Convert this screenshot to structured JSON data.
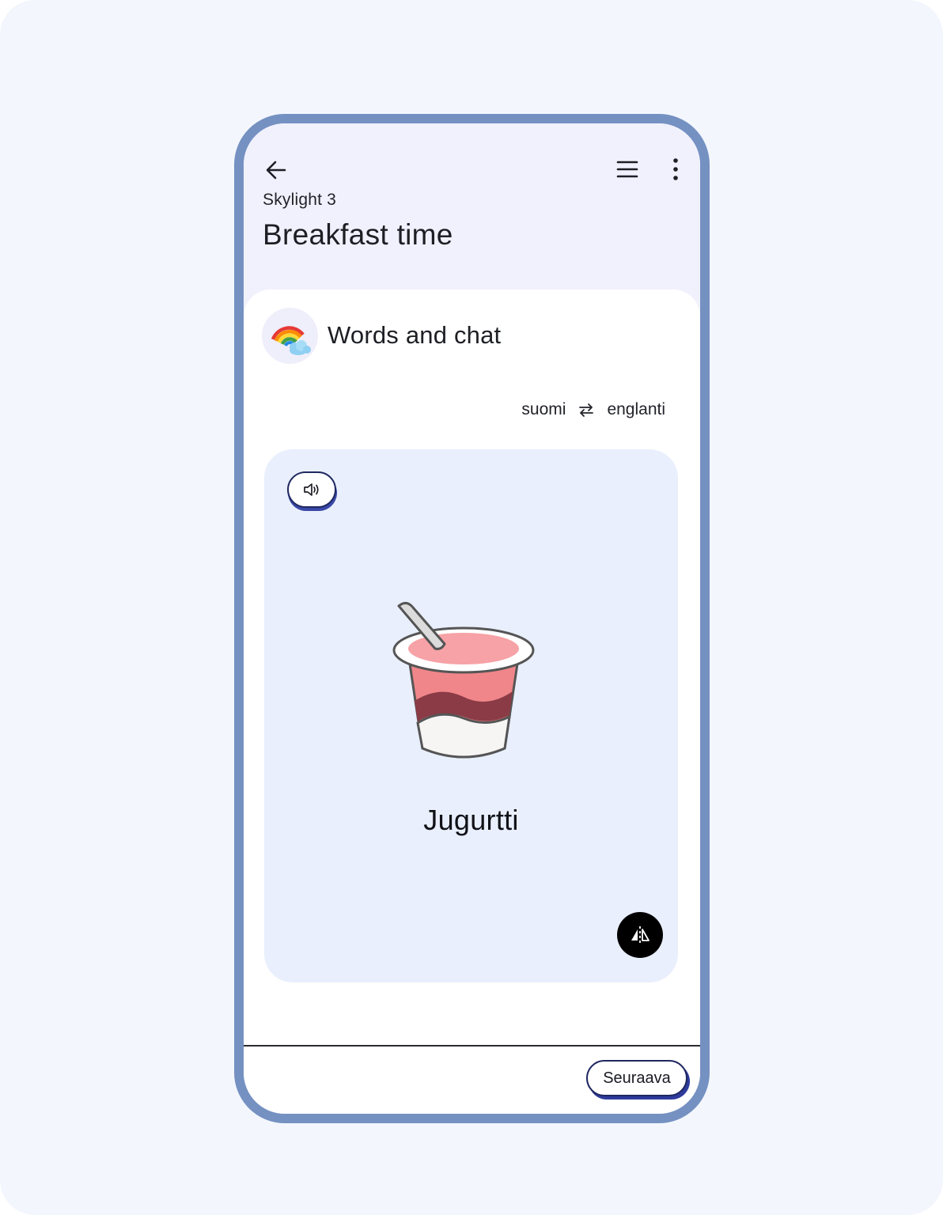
{
  "header": {
    "back_icon": "arrow-left-icon",
    "menu_icon": "hamburger-menu-icon",
    "more_icon": "more-vertical-icon",
    "course": "Skylight 3",
    "title": "Breakfast time"
  },
  "section": {
    "icon": "rainbow-icon",
    "title": "Words and chat"
  },
  "language": {
    "source": "suomi",
    "target": "englanti",
    "swap_icon": "swap-arrows-icon"
  },
  "card": {
    "audio_icon": "speaker-icon",
    "image": "yogurt-cup-illustration",
    "word": "Jugurtti",
    "flip_icon": "flip-icon"
  },
  "footer": {
    "next_label": "Seuraava"
  },
  "colors": {
    "phone_border": "#7591c2",
    "header_bg": "#f1f1fd",
    "card_bg": "#e9effc",
    "button_border": "#1f2860"
  }
}
